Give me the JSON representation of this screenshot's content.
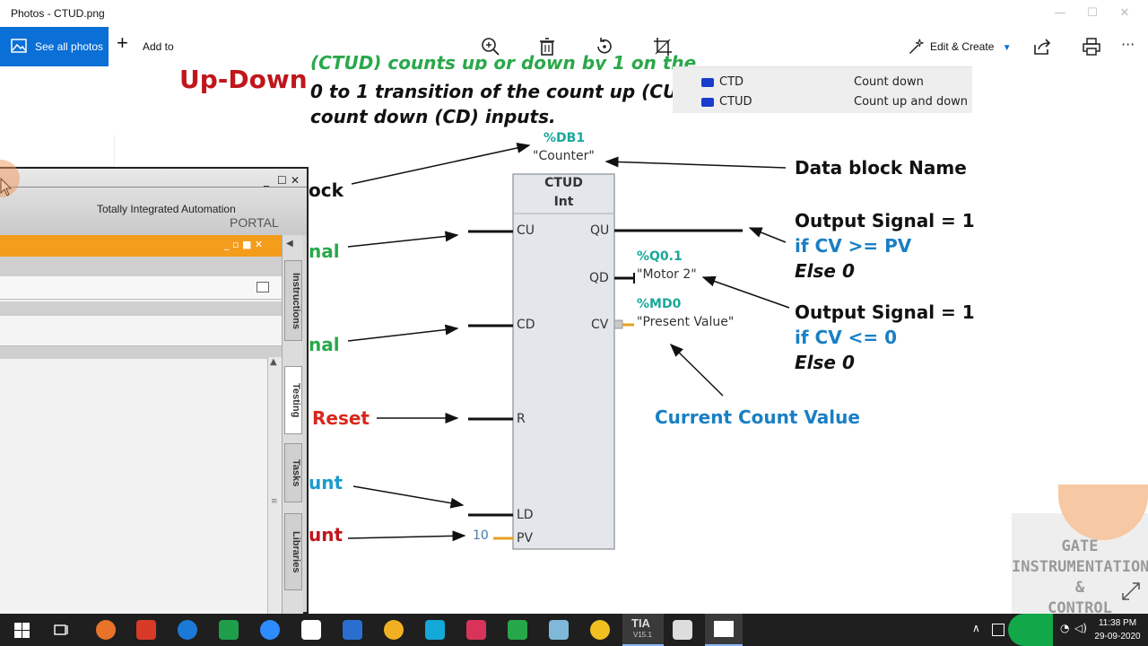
{
  "window": {
    "title": "Photos - CTUD.png",
    "controls": [
      "—",
      "☐",
      "✕"
    ]
  },
  "toolbar": {
    "see_all_label": "See all photos",
    "add_to_label": "Add to",
    "edit_create_label": "Edit & Create",
    "more_label": "···",
    "icons": [
      "zoom-icon",
      "delete-icon",
      "rotate-icon",
      "crop-icon",
      "share-icon",
      "print-icon"
    ]
  },
  "slide": {
    "heading": "Up-Down",
    "desc_line1": "(CTUD) counts up or down by 1 on the",
    "desc_line2": "0 to 1 transition of the count up (CU) or",
    "desc_line3": "count down (CD) inputs.",
    "instructions": [
      {
        "name": "CTD",
        "desc": "Count down"
      },
      {
        "name": "CTUD",
        "desc": "Count up and down"
      }
    ],
    "left_labels": [
      {
        "text": "ock",
        "color": "#111111"
      },
      {
        "text": "nal",
        "color": "#2aa84a"
      },
      {
        "text": "nal",
        "color": "#2aa84a"
      },
      {
        "text": "Reset",
        "color": "#d9261c"
      },
      {
        "text": "unt",
        "color": "#1a9bd0"
      },
      {
        "text": "unt",
        "color": "#c0161c"
      }
    ],
    "block": {
      "db_addr": "%DB1",
      "db_name": "\"Counter\"",
      "type": "CTUD",
      "dtype": "Int",
      "in_pins": [
        "CU",
        "CD",
        "R",
        "LD",
        "PV"
      ],
      "out_pins": [
        "QU",
        "QD",
        "CV"
      ],
      "pv_value": "10",
      "qd_addr": "%Q0.1",
      "qd_name": "\"Motor 2\"",
      "cv_addr": "%MD0",
      "cv_name": "\"Present Value\""
    },
    "annotations": {
      "db_name": "Data block Name",
      "out1_title": "Output Signal = 1",
      "out1_cond": "if CV >= PV",
      "out1_else": "Else 0",
      "out2_title": "Output Signal = 1",
      "out2_cond": "if CV <= 0",
      "out2_else": "Else 0",
      "cv_label": "Current Count Value"
    }
  },
  "tia": {
    "title": "Totally Integrated Automation",
    "portal": "PORTAL",
    "side_tabs": [
      "Instructions",
      "Testing",
      "Tasks",
      "Libraries"
    ]
  },
  "watermark": {
    "line1": "GATE",
    "line2": "INSTRUMENTATION",
    "line3": "&",
    "line4": "CONTROL"
  },
  "taskbar": {
    "time": "11:38 PM",
    "date": "29-09-2020",
    "tia_label": "TIA",
    "tia_version": "V15.1"
  }
}
